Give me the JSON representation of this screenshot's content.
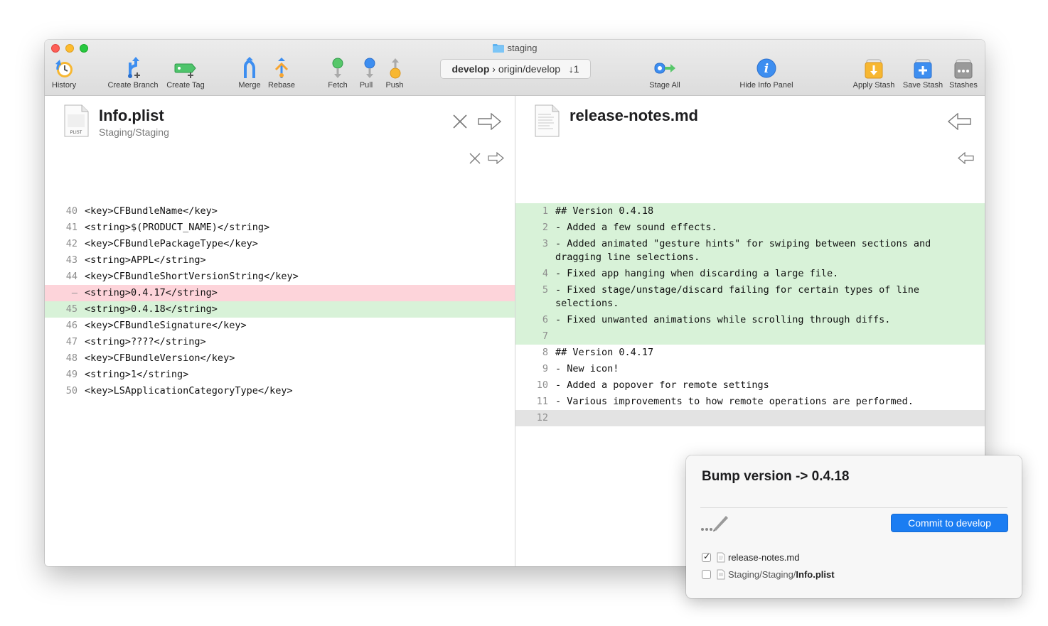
{
  "window": {
    "title": "staging"
  },
  "toolbar": {
    "history": "History",
    "create_branch": "Create Branch",
    "create_tag": "Create Tag",
    "merge": "Merge",
    "rebase": "Rebase",
    "fetch": "Fetch",
    "pull": "Pull",
    "push": "Push",
    "branch_local": "develop",
    "branch_remote": "› origin/develop",
    "branch_behind": "↓1",
    "stage_all": "Stage All",
    "hide_info": "Hide Info Panel",
    "apply_stash": "Apply Stash",
    "save_stash": "Save Stash",
    "stashes": "Stashes"
  },
  "left_file": {
    "name": "Info.plist",
    "path": "Staging/Staging",
    "icon_label": "PLIST",
    "lines": [
      {
        "num": "40",
        "text": "<key>CFBundleName</key>",
        "type": "ctx"
      },
      {
        "num": "41",
        "text": "<string>$(PRODUCT_NAME)</string>",
        "type": "ctx"
      },
      {
        "num": "42",
        "text": "<key>CFBundlePackageType</key>",
        "type": "ctx"
      },
      {
        "num": "43",
        "text": "<string>APPL</string>",
        "type": "ctx"
      },
      {
        "num": "44",
        "text": "<key>CFBundleShortVersionString</key>",
        "type": "ctx"
      },
      {
        "num": "–",
        "text": "<string>0.4.17</string>",
        "type": "del"
      },
      {
        "num": "45",
        "text": "<string>0.4.18</string>",
        "type": "add"
      },
      {
        "num": "46",
        "text": "<key>CFBundleSignature</key>",
        "type": "ctx"
      },
      {
        "num": "47",
        "text": "<string>????</string>",
        "type": "ctx"
      },
      {
        "num": "48",
        "text": "<key>CFBundleVersion</key>",
        "type": "ctx"
      },
      {
        "num": "49",
        "text": "<string>1</string>",
        "type": "ctx"
      },
      {
        "num": "50",
        "text": "<key>LSApplicationCategoryType</key>",
        "type": "ctx"
      }
    ]
  },
  "right_file": {
    "name": "release-notes.md",
    "lines": [
      {
        "num": "1",
        "text": "## Version 0.4.18",
        "type": "add"
      },
      {
        "num": "2",
        "text": "- Added a few sound effects.",
        "type": "add"
      },
      {
        "num": "3",
        "text": "- Added animated \"gesture hints\" for swiping between sections and dragging line selections.",
        "type": "add"
      },
      {
        "num": "4",
        "text": "- Fixed app hanging when discarding a large file.",
        "type": "add"
      },
      {
        "num": "5",
        "text": "- Fixed stage/unstage/discard failing for certain types of line selections.",
        "type": "add"
      },
      {
        "num": "6",
        "text": "- Fixed unwanted animations while scrolling through diffs.",
        "type": "add"
      },
      {
        "num": "7",
        "text": "",
        "type": "add"
      },
      {
        "num": "8",
        "text": "## Version 0.4.17",
        "type": "ctx"
      },
      {
        "num": "9",
        "text": "- New icon!",
        "type": "ctx"
      },
      {
        "num": "10",
        "text": "- Added a popover for remote settings",
        "type": "ctx"
      },
      {
        "num": "11",
        "text": "- Various improvements to how remote operations are performed.",
        "type": "ctx"
      },
      {
        "num": "12",
        "text": "",
        "type": "gray"
      }
    ]
  },
  "commit_panel": {
    "message": "Bump version -> 0.4.18",
    "commit_button": "Commit to develop",
    "files": [
      {
        "checked": true,
        "path_prefix": "",
        "name": "release-notes.md"
      },
      {
        "checked": false,
        "path_prefix": "Staging/Staging/",
        "name": "Info.plist"
      }
    ]
  },
  "colors": {
    "added_bg": "#d8f2d8",
    "deleted_bg": "#fdd4da",
    "accent": "#1b7df2"
  }
}
